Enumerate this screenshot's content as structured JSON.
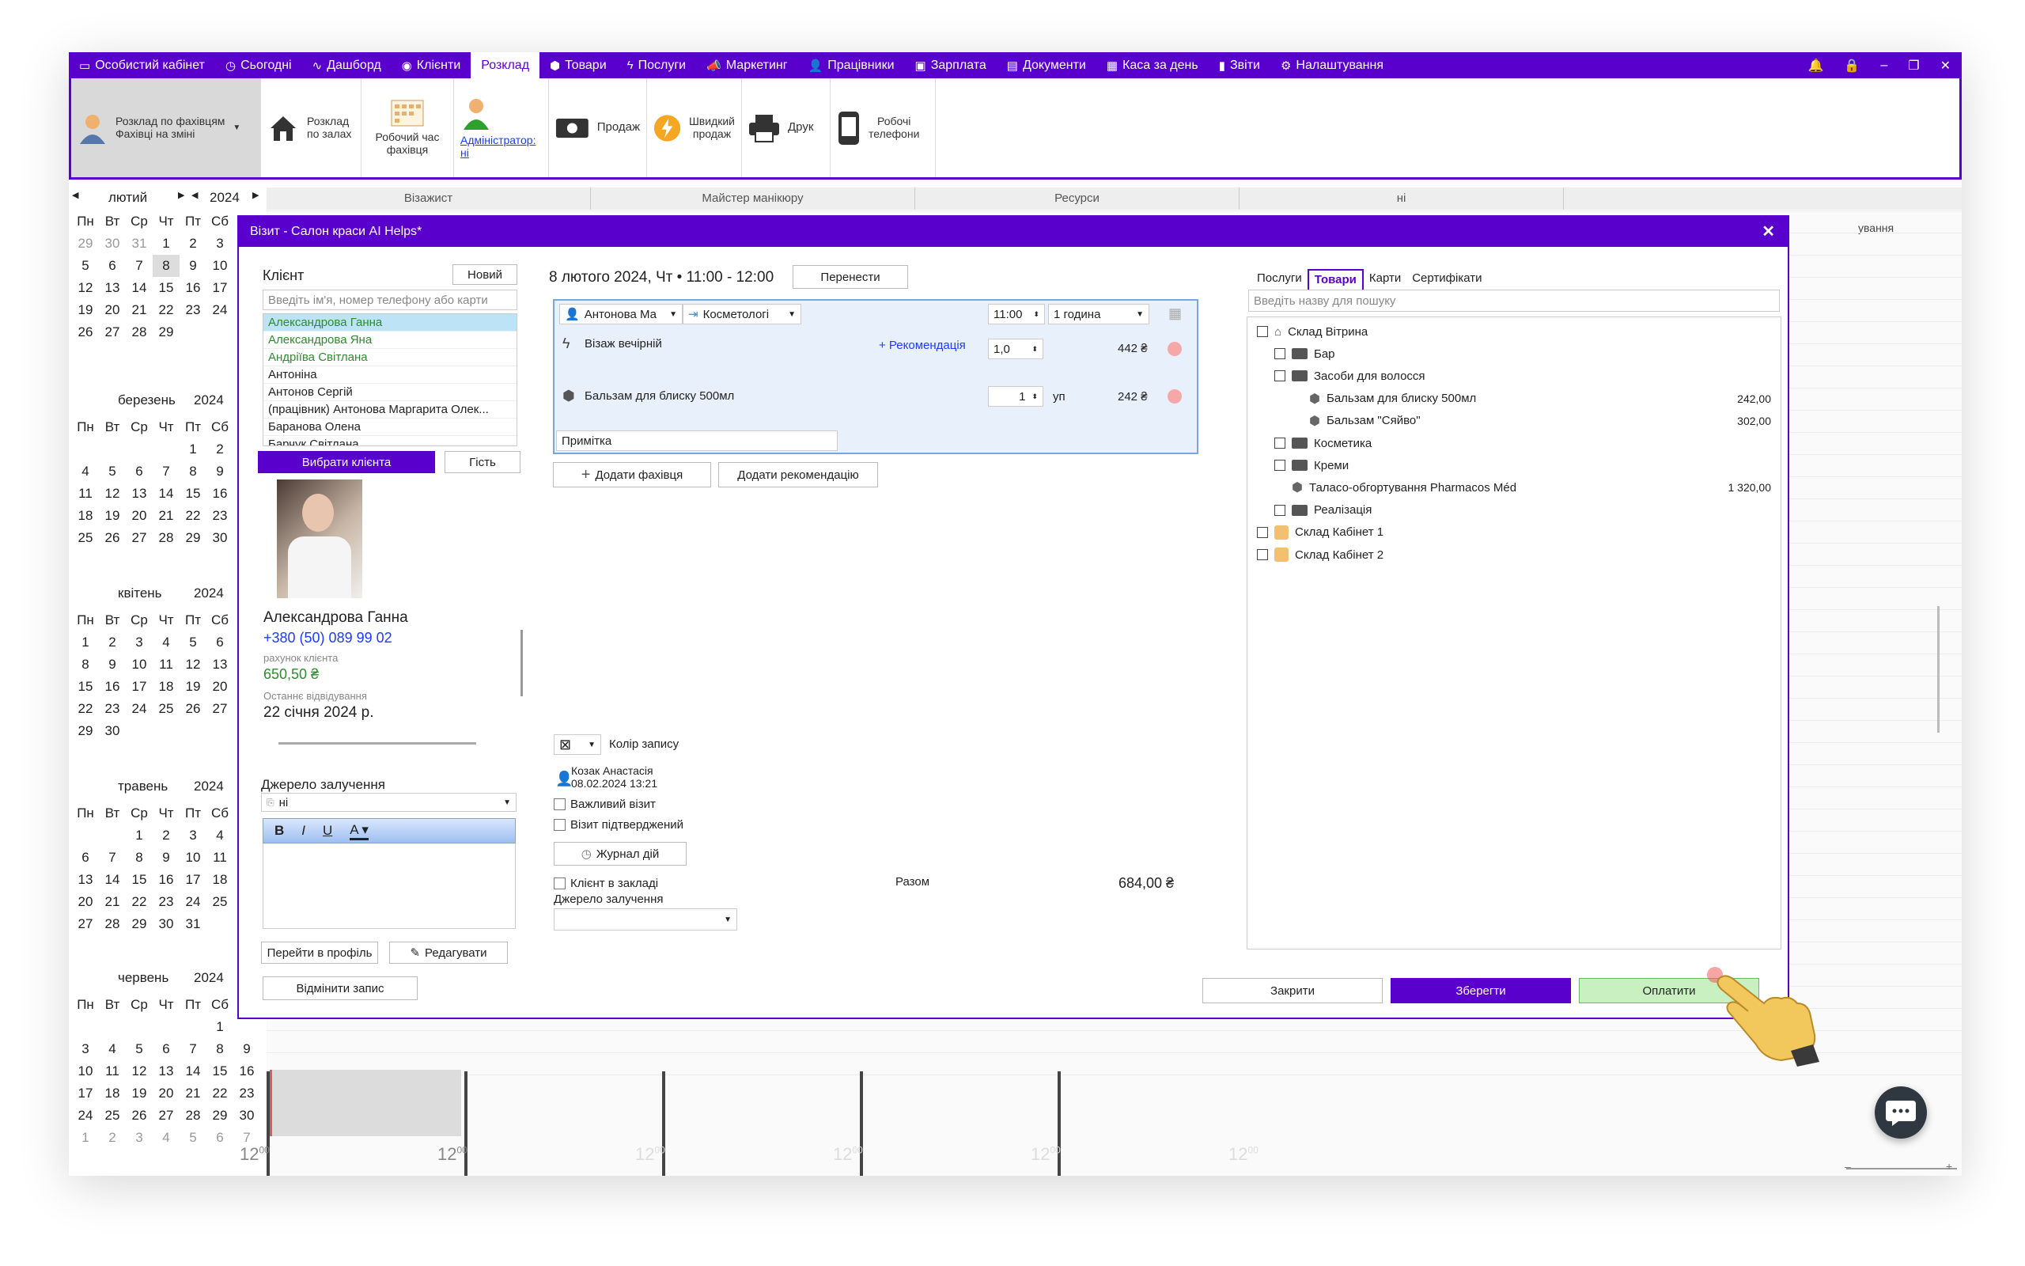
{
  "menu": {
    "items": [
      {
        "label": "Особистий кабінет",
        "icon": "cabinet-icon"
      },
      {
        "label": "Сьогодні",
        "icon": "clock-icon"
      },
      {
        "label": "Дашборд",
        "icon": "pulse-icon"
      },
      {
        "label": "Клієнти",
        "icon": "user-circle-icon"
      },
      {
        "label": "Розклад",
        "icon": ""
      },
      {
        "label": "Товари",
        "icon": "cube-icon"
      },
      {
        "label": "Послуги",
        "icon": "bolt-icon"
      },
      {
        "label": "Маркетинг",
        "icon": "megaphone-icon"
      },
      {
        "label": "Працівники",
        "icon": "person-icon"
      },
      {
        "label": "Зарплата",
        "icon": "money-icon"
      },
      {
        "label": "Документи",
        "icon": "document-icon"
      },
      {
        "label": "Каса за день",
        "icon": "calculator-icon"
      },
      {
        "label": "Звіти",
        "icon": "bar-chart-icon"
      },
      {
        "label": "Налаштування",
        "icon": "gear-icon"
      }
    ],
    "active": "Розклад",
    "accent": "#5a00cc"
  },
  "ribbon": {
    "schedule_by_specialist": "Розклад по фахівцям",
    "specialists_on_shift": "Фахівці на зміні",
    "schedule_by_halls_1": "Розклад",
    "schedule_by_halls_2": "по залах",
    "work_time_1": "Робочий час",
    "work_time_2": "фахівця",
    "admin_1": "Адміністратор:",
    "admin_2": "ні",
    "sale": "Продаж",
    "quick_sale_1": "Швидкий",
    "quick_sale_2": "продаж",
    "print": "Друк",
    "work_phones_1": "Робочі",
    "work_phones_2": "телефони"
  },
  "calendar": {
    "top": {
      "month": "лютий",
      "year": "2024"
    },
    "weekdays": [
      "Пн",
      "Вт",
      "Ср",
      "Чт",
      "Пт",
      "Сб"
    ],
    "feb": {
      "rows": [
        [
          "29",
          "30",
          "31",
          "1",
          "2",
          "3"
        ],
        [
          "5",
          "6",
          "7",
          "8",
          "9",
          "10"
        ],
        [
          "12",
          "13",
          "14",
          "15",
          "16",
          "17"
        ],
        [
          "19",
          "20",
          "21",
          "22",
          "23",
          "24"
        ],
        [
          "26",
          "27",
          "28",
          "29",
          "",
          ""
        ]
      ]
    },
    "mar": {
      "month": "березень",
      "year": "2024",
      "rows": [
        [
          "",
          "",
          "",
          "",
          "1",
          "2"
        ],
        [
          "4",
          "5",
          "6",
          "7",
          "8",
          "9"
        ],
        [
          "11",
          "12",
          "13",
          "14",
          "15",
          "16"
        ],
        [
          "18",
          "19",
          "20",
          "21",
          "22",
          "23"
        ],
        [
          "25",
          "26",
          "27",
          "28",
          "29",
          "30"
        ]
      ]
    },
    "apr": {
      "month": "квітень",
      "year": "2024",
      "rows": [
        [
          "1",
          "2",
          "3",
          "4",
          "5",
          "6"
        ],
        [
          "8",
          "9",
          "10",
          "11",
          "12",
          "13"
        ],
        [
          "15",
          "16",
          "17",
          "18",
          "19",
          "20"
        ],
        [
          "22",
          "23",
          "24",
          "25",
          "26",
          "27"
        ],
        [
          "29",
          "30",
          "",
          "",
          "",
          ""
        ]
      ]
    },
    "may": {
      "month": "травень",
      "year": "2024",
      "rows": [
        [
          "",
          "",
          "1",
          "2",
          "3",
          "4"
        ],
        [
          "6",
          "7",
          "8",
          "9",
          "10",
          "11"
        ],
        [
          "13",
          "14",
          "15",
          "16",
          "17",
          "18"
        ],
        [
          "20",
          "21",
          "22",
          "23",
          "24",
          "25"
        ],
        [
          "27",
          "28",
          "29",
          "30",
          "31",
          ""
        ]
      ]
    },
    "jun": {
      "month": "червень",
      "year": "2024",
      "rows": [
        [
          "",
          "",
          "",
          "",
          "",
          "1"
        ],
        [
          "3",
          "4",
          "5",
          "6",
          "7",
          "8"
        ],
        [
          "10",
          "11",
          "12",
          "13",
          "14",
          "15"
        ],
        [
          "17",
          "18",
          "19",
          "20",
          "21",
          "22"
        ],
        [
          "24",
          "25",
          "26",
          "27",
          "28",
          "29"
        ],
        [
          "1",
          "2",
          "3",
          "4",
          "5",
          "6"
        ]
      ],
      "extra_col": [
        "",
        "9",
        "16",
        "23",
        "30",
        "7"
      ]
    }
  },
  "schedule": {
    "columns": [
      "Візажист",
      "Майстер манікюру",
      "Ресурси",
      "ні"
    ],
    "side_label": "ування",
    "time_labels": [
      "12",
      "12",
      "12",
      "12",
      "12",
      "12"
    ],
    "sup": "00"
  },
  "dialog": {
    "title": "Візит - Салон краси AI Helps*",
    "client_label": "Клієнт",
    "new_button": "Новий",
    "search_placeholder": "Введіть ім'я, номер телефону або карти",
    "clients": [
      "Александрова Ганна",
      "Александрова Яна",
      "Андріїва Світлана",
      "Антоніна",
      "Антонов Сергій",
      "(працівник) Антонова Маргарита Олек...",
      "Баранова Олена",
      "Барчук Світлана"
    ],
    "choose_client": "Вибрати клієнта",
    "guest": "Гість",
    "client_name": "Александрова Ганна",
    "client_phone": "+380 (50) 089 99 02",
    "account_label": "рахунок клієнта",
    "account_value": "650,50 ₴",
    "last_visit_label": "Останнє відвідування",
    "last_visit": "22 січня 2024 р.",
    "source_label": "Джерело залучення",
    "source_value": "ні",
    "goto_profile": "Перейти в профіль",
    "edit": "Редагувати",
    "cancel_record": "Відмінити запис",
    "date_line": "8 лютого 2024, Чт • 11:00 - 12:00",
    "move": "Перенести",
    "specialist": "Антонова Ма",
    "category": "Косметологі",
    "time": "11:00",
    "duration": "1 година",
    "service": "Візаж вечірній",
    "recommend": "+ Рекомендація",
    "service_qty": "1,0",
    "service_price": "442 ₴",
    "product": "Бальзам для блиску 500мл",
    "product_qty": "1",
    "product_unit": "уп",
    "product_price": "242 ₴",
    "note": "Примітка",
    "add_specialist": "Додати фахівця",
    "add_recommendation": "Додати рекомендацію",
    "color_label": "Колір запису",
    "author": "Козак Анастасія",
    "author_date": "08.02.2024 13:21",
    "important": "Важливий візит",
    "confirmed": "Візит підтверджений",
    "journal": "Журнал дій",
    "client_in_salon": "Клієнт в закладі",
    "source2": "Джерело залучення",
    "total_label": "Разом",
    "total_value": "684,00 ₴",
    "tabs": [
      "Послуги",
      "Товари",
      "Карти",
      "Сертифікати"
    ],
    "active_tab": "Товари",
    "product_search": "Введіть назву для пошуку",
    "tree": [
      {
        "label": "Склад Вітрина",
        "level": 0,
        "kind": "store",
        "price": ""
      },
      {
        "label": "Бар",
        "level": 1,
        "kind": "folder",
        "price": ""
      },
      {
        "label": "Засоби для волосся",
        "level": 1,
        "kind": "folder",
        "price": ""
      },
      {
        "label": "Бальзам для блиску 500мл",
        "level": 2,
        "kind": "item",
        "price": "242,00"
      },
      {
        "label": "Бальзам \"Сяйво\"",
        "level": 2,
        "kind": "item",
        "price": "302,00"
      },
      {
        "label": "Косметика",
        "level": 1,
        "kind": "folder",
        "price": ""
      },
      {
        "label": "Креми",
        "level": 1,
        "kind": "folder",
        "price": ""
      },
      {
        "label": "Таласо-обгортування Pharmacos Méd",
        "level": 1,
        "kind": "item",
        "price": "1 320,00"
      },
      {
        "label": "Реалізація",
        "level": 1,
        "kind": "folder",
        "price": ""
      },
      {
        "label": "Склад Кабінет 1",
        "level": 0,
        "kind": "cabinet",
        "price": ""
      },
      {
        "label": "Склад Кабінет 2",
        "level": 0,
        "kind": "cabinet",
        "price": ""
      }
    ],
    "close": "Закрити",
    "save": "Зберегти",
    "pay": "Оплатити"
  },
  "colors": {
    "accent": "#5a00cc",
    "pay_green": "#c9f0c0",
    "link": "#1a3cff",
    "money_green": "#2e8b2e"
  }
}
